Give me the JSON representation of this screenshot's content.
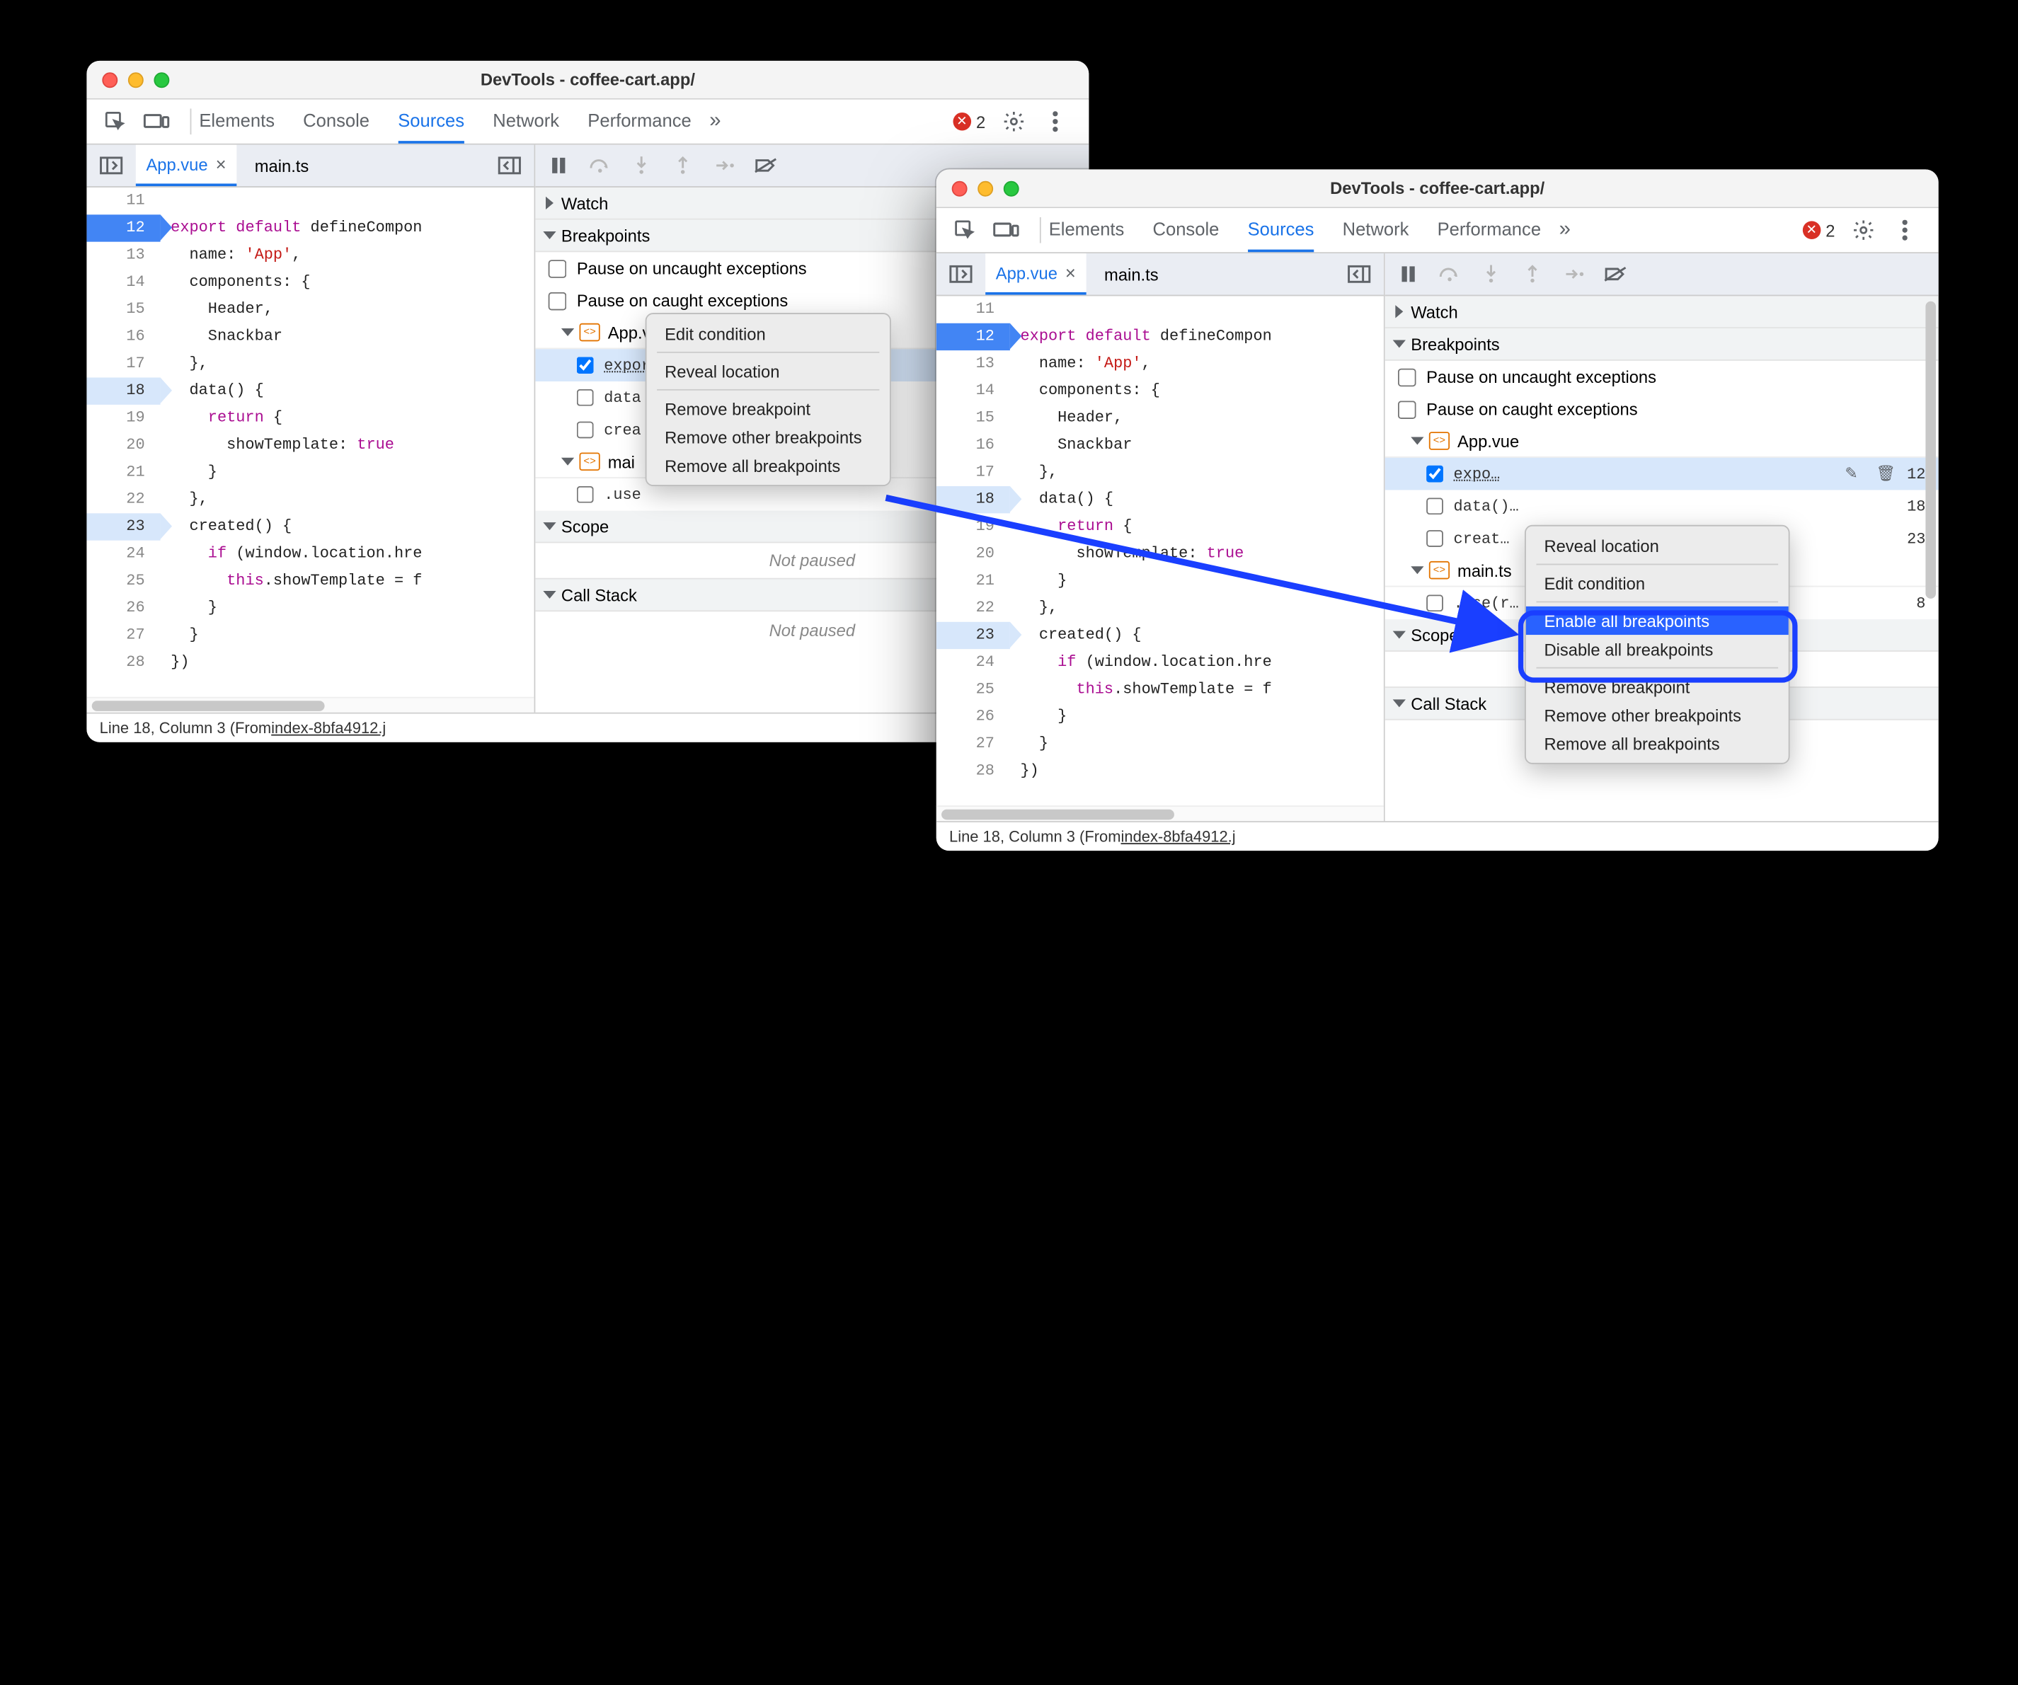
{
  "windows": {
    "title": "DevTools - coffee-cart.app/",
    "tabs": [
      "Elements",
      "Console",
      "Sources",
      "Network",
      "Performance"
    ],
    "activeTab": "Sources",
    "errorCount": "2",
    "files": {
      "items": [
        {
          "name": "App.vue",
          "active": true
        },
        {
          "name": "main.ts",
          "active": false
        }
      ]
    },
    "code": {
      "startLine": 11,
      "breakpointLines": [
        18,
        23
      ],
      "solidBreakpoint": 12,
      "lines": [
        {
          "n": 11,
          "html": ""
        },
        {
          "n": 12,
          "html": "<span class='kw'>export</span> <span class='kw'>default</span> defineCompon"
        },
        {
          "n": 13,
          "html": "  name: <span class='str'>'App'</span>,"
        },
        {
          "n": 14,
          "html": "  components: {"
        },
        {
          "n": 15,
          "html": "    Header,"
        },
        {
          "n": 16,
          "html": "    Snackbar"
        },
        {
          "n": 17,
          "html": "  },"
        },
        {
          "n": 18,
          "html": "  data() {"
        },
        {
          "n": 19,
          "html": "    <span class='kw'>return</span> {"
        },
        {
          "n": 20,
          "html": "      showTemplate: <span class='lit'>true</span>"
        },
        {
          "n": 21,
          "html": "    }"
        },
        {
          "n": 22,
          "html": "  },"
        },
        {
          "n": 23,
          "html": "  created() {"
        },
        {
          "n": 24,
          "html": "    <span class='kw'>if</span> (window.location.hre"
        },
        {
          "n": 25,
          "html": "      <span class='kw'>this</span>.showTemplate = f"
        },
        {
          "n": 26,
          "html": "    }"
        },
        {
          "n": 27,
          "html": "  }"
        },
        {
          "n": 28,
          "html": "})"
        }
      ]
    },
    "statusPrefix": "Line 18, Column 3  (From ",
    "statusLink": "index-8bfa4912.j",
    "right": {
      "watch": "Watch",
      "breakpoints": "Breakpoints",
      "pauseUncaught": "Pause on uncaught exceptions",
      "pauseCaught": "Pause on caught exceptions",
      "bpGroup1": "App.vue",
      "bpGroup2": "main.ts",
      "items1": [
        {
          "label": "export default defineCompon…",
          "checked": true,
          "ln": "12"
        },
        {
          "label": "data() {",
          "checked": false,
          "ln": "18"
        },
        {
          "label": "created() {",
          "checked": false,
          "ln": "23"
        }
      ],
      "items1_b_labels": [
        "expo…",
        "data()…",
        "creat…"
      ],
      "items2": [
        {
          "label": ".use(r…",
          "checked": false,
          "ln": "8"
        }
      ],
      "scope": "Scope",
      "callStack": "Call Stack",
      "notPaused": "Not paused"
    }
  },
  "contextA": {
    "editCondition": "Edit condition",
    "reveal": "Reveal location",
    "remove": "Remove breakpoint",
    "removeOther": "Remove other breakpoints",
    "removeAll": "Remove all breakpoints"
  },
  "contextB": {
    "reveal": "Reveal location",
    "editCondition": "Edit condition",
    "enableAll": "Enable all breakpoints",
    "disableAll": "Disable all breakpoints",
    "remove": "Remove breakpoint",
    "removeOther": "Remove other breakpoints",
    "removeAll": "Remove all breakpoints"
  }
}
